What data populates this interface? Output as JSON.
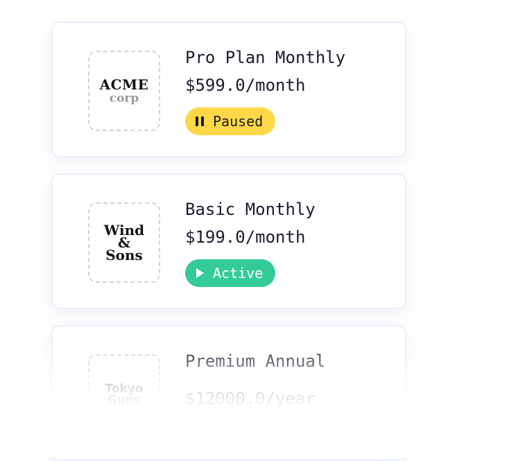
{
  "subscriptions": [
    {
      "logo": {
        "line1": "ACME",
        "line2": "corp"
      },
      "plan": "Pro Plan Monthly",
      "price": "$599.0/month",
      "status": {
        "label": "Paused",
        "icon": "pause-icon",
        "color": "#ffd84a"
      }
    },
    {
      "logo": {
        "line1": "Wind",
        "line2": "&",
        "line3": "Sons"
      },
      "plan": "Basic Monthly",
      "price": "$199.0/month",
      "status": {
        "label": "Active",
        "icon": "play-icon",
        "color": "#33cc99"
      }
    },
    {
      "logo": {
        "line1": "Tokyo",
        "line2": "Guns"
      },
      "plan": "Premium Annual",
      "price": "$12000.0/year"
    }
  ]
}
